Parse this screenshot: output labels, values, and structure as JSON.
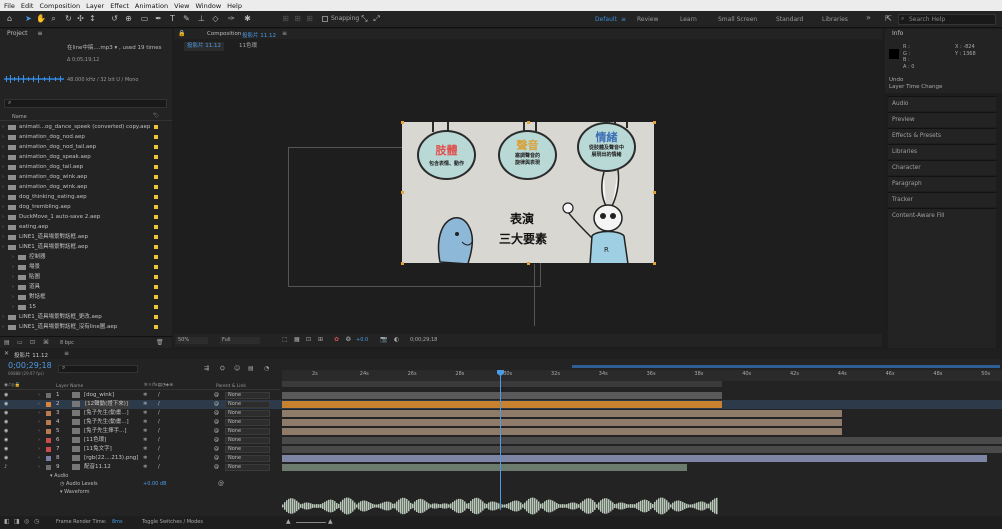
{
  "menu": [
    "File",
    "Edit",
    "Composition",
    "Layer",
    "Effect",
    "Animation",
    "View",
    "Window",
    "Help"
  ],
  "toolbar": {
    "snapping_label": "Snapping"
  },
  "workspaces": {
    "items": [
      "Default",
      "Review",
      "Learn",
      "Small Screen",
      "Standard",
      "Libraries"
    ],
    "active": "Default",
    "more": "»"
  },
  "search_help": {
    "placeholder": "Search Help"
  },
  "project": {
    "title": "Project",
    "file_name": "在line中搞....mp3 ▾ , used 19 times",
    "duration": "Δ 0;05;19;12",
    "audio_info": "48.000 kHz / 32 bit U / Mono",
    "col_name": "Name",
    "bpc": "8 bpc",
    "items": [
      {
        "label": "animati...og_dance_speek (converted) copy.aep",
        "indent": 0
      },
      {
        "label": "animation_dog_nod.aep",
        "indent": 0
      },
      {
        "label": "animation_dog_nod_tail.aep",
        "indent": 0
      },
      {
        "label": "animation_dog_speak.aep",
        "indent": 0
      },
      {
        "label": "animation_dog_tail.aep",
        "indent": 0
      },
      {
        "label": "animation_dog_wink.aep",
        "indent": 0
      },
      {
        "label": "animation_dog_wink.aep",
        "indent": 0
      },
      {
        "label": "dog_thinking_eating.aep",
        "indent": 0
      },
      {
        "label": "dog_trembling.aep",
        "indent": 0
      },
      {
        "label": "DuckMove_1 auto-save 2.aep",
        "indent": 0
      },
      {
        "label": "eating.aep",
        "indent": 0
      },
      {
        "label": "LINE1_道具場景對話框.aep",
        "indent": 0
      },
      {
        "label": "LINE1_道具場景對話框.aep",
        "indent": 0
      },
      {
        "label": "控制器",
        "indent": 1
      },
      {
        "label": "場景",
        "indent": 1
      },
      {
        "label": "貼圖",
        "indent": 1
      },
      {
        "label": "道具",
        "indent": 1
      },
      {
        "label": "對話框",
        "indent": 1
      },
      {
        "label": "15",
        "indent": 1
      },
      {
        "label": "LINE1_道具場景對話框_更改.aep",
        "indent": 0
      },
      {
        "label": "LINE1_道具場景對話框_沒有line圖.aep",
        "indent": 0
      }
    ]
  },
  "composition": {
    "title": "Composition",
    "comp_name": "投影片 11.12",
    "tab1": "投影片 11.12",
    "tab2": "11色環",
    "zoom": "50%",
    "resolution": "Full",
    "exposure": "+0.0",
    "timecode": "0;00;29;18"
  },
  "slide": {
    "circle1": {
      "title": "肢體",
      "sub": "包含表情、動作",
      "title_color": "#e0524f"
    },
    "circle2": {
      "title": "聲音",
      "sub": "塞調聲音的\n旋律與表現",
      "title_color": "#d9a23a"
    },
    "circle3": {
      "title": "情緒",
      "sub": "從肢體及聲音中\n展現出的情緒",
      "title_color": "#3c6fb6"
    },
    "main_line1": "表演",
    "main_line2": "三大要素",
    "bg_color": "#d9d7d1",
    "circle_color": "#b9d9d6"
  },
  "info": {
    "title": "Info",
    "r": "R :",
    "g": "G :",
    "b": "B :",
    "a": "A : 0",
    "x": "X : -824",
    "y": "Y : 1368",
    "undo_label": "Undo",
    "undo_value": "Layer Time Change"
  },
  "right_panels": [
    "Audio",
    "Preview",
    "Effects & Presets",
    "Libraries",
    "Character",
    "Paragraph",
    "Tracker",
    "Content-Aware Fill"
  ],
  "timeline": {
    "comp_tab": "投影片 11.12",
    "timecode": "0;00;29;18",
    "timecode_sub": "00888 (29.97 fps)",
    "col_layer_name": "Layer Name",
    "col_parent": "Parent & Link",
    "ruler": [
      "2s",
      "24s",
      "26s",
      "28s",
      "30s",
      "32s",
      "34s",
      "36s",
      "38s",
      "40s",
      "42s",
      "44s",
      "46s",
      "48s",
      "50s"
    ],
    "layers": [
      {
        "num": "1",
        "name": "[dog_wink]",
        "color": "#6e6e6e",
        "parent": "None"
      },
      {
        "num": "2",
        "name": "[12聲動(燈下來)]",
        "color": "#d8843a",
        "parent": "None"
      },
      {
        "num": "3",
        "name": "[兔子先生(動畫...]",
        "color": "#b97a4f",
        "parent": "None"
      },
      {
        "num": "4",
        "name": "[兔子先生(動畫...]",
        "color": "#b97a4f",
        "parent": "None"
      },
      {
        "num": "5",
        "name": "[兔子先生揮手...]",
        "color": "#b97a4f",
        "parent": "None"
      },
      {
        "num": "6",
        "name": "[11色環]",
        "color": "#c94b4b",
        "parent": "None"
      },
      {
        "num": "7",
        "name": "[11兔文字]",
        "color": "#c94b4b",
        "parent": "None"
      },
      {
        "num": "8",
        "name": "[rgb(22....213).png]",
        "color": "#7a7fa6",
        "parent": "None"
      },
      {
        "num": "9",
        "name": "配音11.12",
        "color": "#6e6e6e",
        "parent": "None"
      }
    ],
    "audio_label": "Audio",
    "audio_levels_label": "Audio Levels",
    "audio_levels_value": "+0.00 dB",
    "waveform_label": "Waveform",
    "frame_render_label": "Frame Render Time:",
    "frame_render_value": "8ms",
    "toggle_label": "Toggle Switches / Modes"
  }
}
